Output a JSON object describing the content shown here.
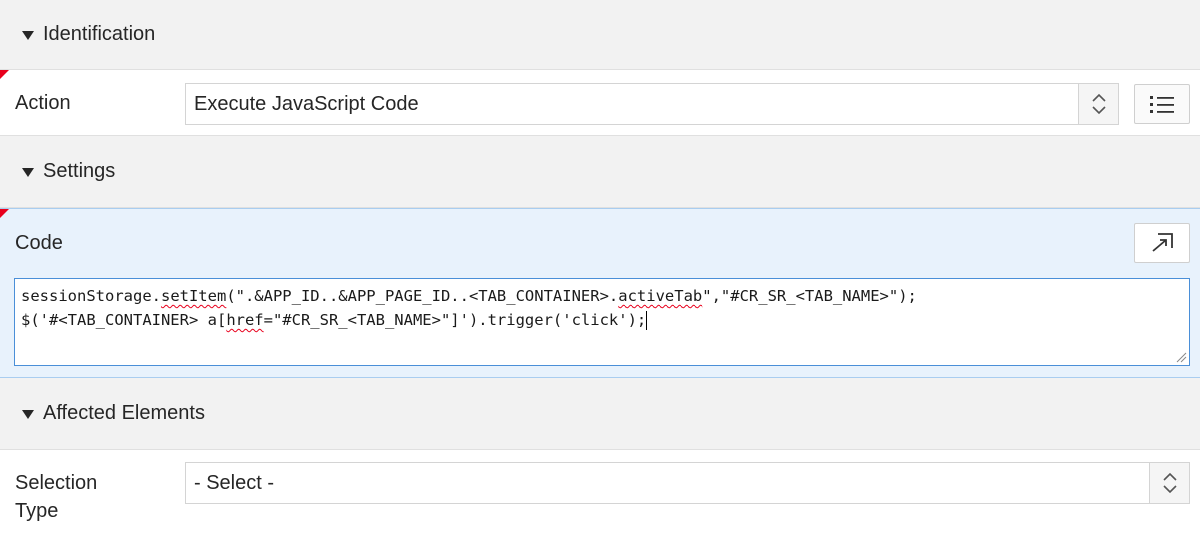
{
  "sections": {
    "identification": "Identification",
    "settings": "Settings",
    "affected_elements": "Affected Elements"
  },
  "action": {
    "label": "Action",
    "value": "Execute JavaScript Code"
  },
  "code": {
    "label": "Code",
    "line1_parts": [
      "sessionStorage.",
      "setItem",
      "(\".&APP_ID..&APP_PAGE_ID..<TAB_CONTAINER>.",
      "activeTab",
      "\",\"#CR_SR_<TAB_NAME>\");"
    ],
    "line2_parts": [
      "$('#<TAB_CONTAINER> a[",
      "href",
      "=\"#CR_SR_<TAB_NAME>\"]').trigger('click');"
    ]
  },
  "selection_type": {
    "label_line1": "Selection",
    "label_line2": "Type",
    "value": "- Select -"
  },
  "icons": {
    "updown": "up-down-chevrons-icon",
    "list": "list-icon",
    "expand": "expand-editor-icon"
  },
  "colors": {
    "header_bg": "#f2f2f2",
    "code_row_bg": "#e8f2fc",
    "required_marker": "#e8001c",
    "focus_border": "#4a8fd8"
  }
}
